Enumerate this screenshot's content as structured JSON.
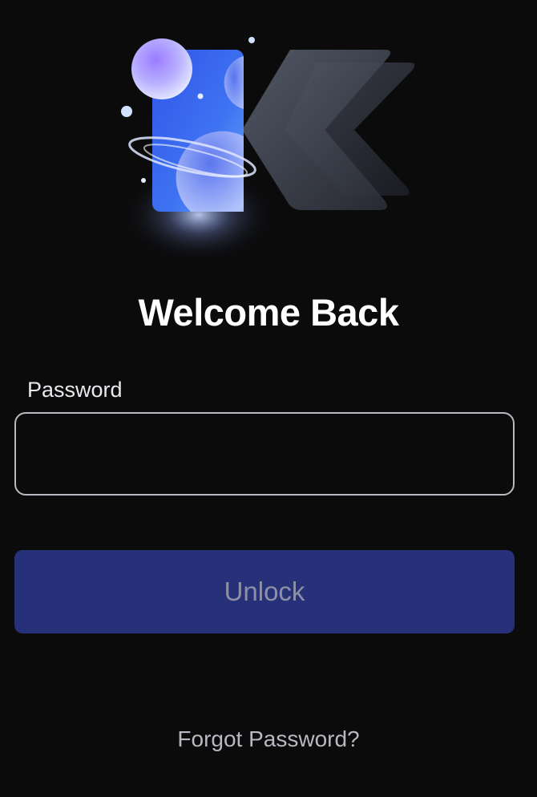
{
  "screen": {
    "title": "Welcome Back",
    "logo_icon": "planet-k-logo-icon"
  },
  "password": {
    "label": "Password",
    "value": "",
    "placeholder": ""
  },
  "unlock": {
    "label": "Unlock"
  },
  "forgot": {
    "label": "Forgot Password?"
  },
  "colors": {
    "background": "#0b0b0c",
    "button": "#27317a",
    "button_text": "#8e90a6",
    "input_border": "#b9b9c2",
    "accent_blue": "#3b5cf0"
  }
}
